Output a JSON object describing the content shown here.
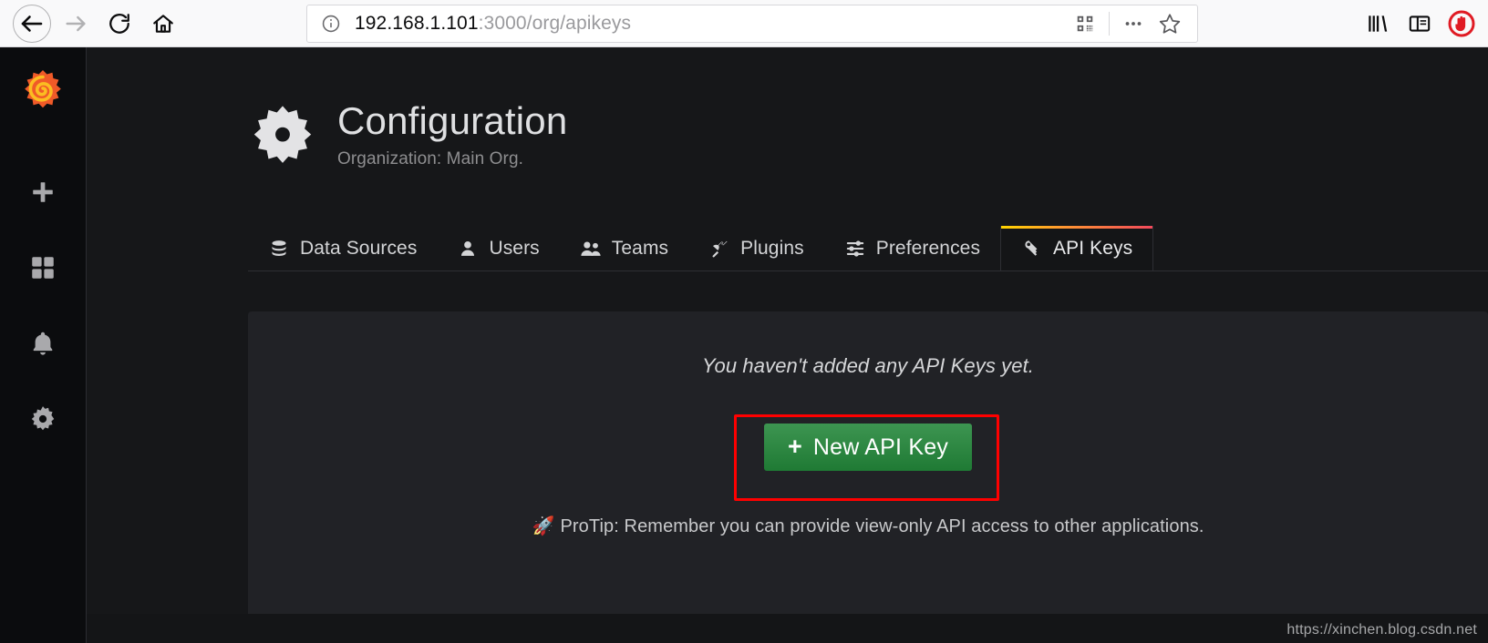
{
  "browser": {
    "back_label": "Back",
    "forward_label": "Forward",
    "reload_label": "Reload",
    "home_label": "Home",
    "url_host": "192.168.1.101",
    "url_path": ":3000/org/apikeys",
    "url_full": "192.168.1.101:3000/org/apikeys",
    "site_info_icon": "info-circle-icon",
    "qr_icon": "qr-code-icon",
    "page_actions_icon": "ellipsis-icon",
    "bookmark_icon": "star-icon",
    "library_icon": "library-icon",
    "sidebar_icon": "sidebar-icon",
    "blocker_icon": "shield-blocker-icon"
  },
  "sidebar": {
    "logo": "grafana-logo-icon",
    "items": [
      {
        "icon": "plus-icon",
        "label": "Create"
      },
      {
        "icon": "dashboards-squares-icon",
        "label": "Dashboards"
      },
      {
        "icon": "bell-icon",
        "label": "Alerting"
      },
      {
        "icon": "gear-icon",
        "label": "Configuration"
      }
    ]
  },
  "header": {
    "icon": "gear-icon",
    "title": "Configuration",
    "subtitle": "Organization: Main Org."
  },
  "tabs": [
    {
      "label": "Data Sources",
      "icon": "database-icon",
      "active": false
    },
    {
      "label": "Users",
      "icon": "user-icon",
      "active": false
    },
    {
      "label": "Teams",
      "icon": "users-group-icon",
      "active": false
    },
    {
      "label": "Plugins",
      "icon": "plug-icon",
      "active": false
    },
    {
      "label": "Preferences",
      "icon": "sliders-icon",
      "active": false
    },
    {
      "label": "API Keys",
      "icon": "key-icon",
      "active": true
    }
  ],
  "panel": {
    "empty_message": "You haven't added any API Keys yet.",
    "new_key_button": "New API Key",
    "new_key_plus": "+",
    "protip_rocket": "🚀",
    "protip_text": "ProTip: Remember you can provide view-only API access to other applications."
  },
  "annotation": {
    "color": "#ff0000",
    "target": "new-api-key-button"
  },
  "watermark": {
    "text": "https://xinchen.blog.csdn.net"
  },
  "colors": {
    "page_bg": "#161719",
    "panel_bg": "#212226",
    "sidebar_bg": "#0b0c0e",
    "accent_green": "#2f8a42",
    "tab_accent_start": "#ffd500",
    "tab_accent_end": "#f2495c",
    "annotation_red": "#ff0000"
  }
}
